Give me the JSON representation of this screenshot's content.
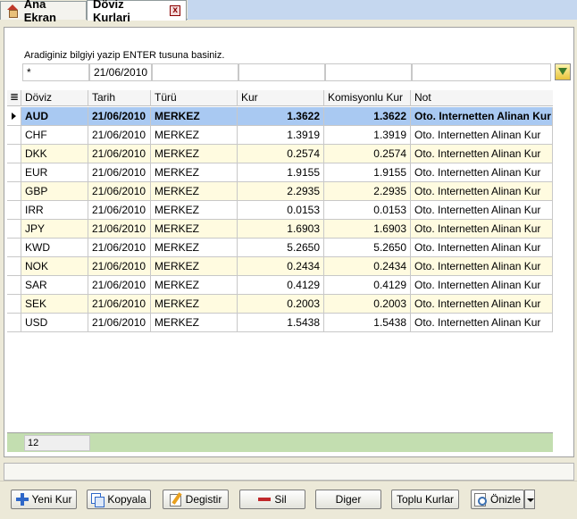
{
  "tabs": {
    "home_label": "Ana Ekran",
    "active_label": "Döviz Kurlari",
    "close_glyph": "x"
  },
  "search": {
    "hint": "Aradiginiz bilgiyi yazip ENTER tusuna basiniz.",
    "filter_doviz": "*",
    "filter_tarih": "21/06/2010",
    "filter_turu": "",
    "filter_kur": "",
    "filter_komisyonlu": "",
    "filter_not": ""
  },
  "grid": {
    "columns": [
      "Döviz",
      "Tarih",
      "Türü",
      "Kur",
      "Komisyonlu Kur",
      "Not"
    ],
    "rows": [
      [
        "AUD",
        "21/06/2010",
        "MERKEZ",
        "1.3622",
        "1.3622",
        "Oto. Internetten Alinan Kur"
      ],
      [
        "CHF",
        "21/06/2010",
        "MERKEZ",
        "1.3919",
        "1.3919",
        "Oto. Internetten Alinan Kur"
      ],
      [
        "DKK",
        "21/06/2010",
        "MERKEZ",
        "0.2574",
        "0.2574",
        "Oto. Internetten Alinan Kur"
      ],
      [
        "EUR",
        "21/06/2010",
        "MERKEZ",
        "1.9155",
        "1.9155",
        "Oto. Internetten Alinan Kur"
      ],
      [
        "GBP",
        "21/06/2010",
        "MERKEZ",
        "2.2935",
        "2.2935",
        "Oto. Internetten Alinan Kur"
      ],
      [
        "IRR",
        "21/06/2010",
        "MERKEZ",
        "0.0153",
        "0.0153",
        "Oto. Internetten Alinan Kur"
      ],
      [
        "JPY",
        "21/06/2010",
        "MERKEZ",
        "1.6903",
        "1.6903",
        "Oto. Internetten Alinan Kur"
      ],
      [
        "KWD",
        "21/06/2010",
        "MERKEZ",
        "5.2650",
        "5.2650",
        "Oto. Internetten Alinan Kur"
      ],
      [
        "NOK",
        "21/06/2010",
        "MERKEZ",
        "0.2434",
        "0.2434",
        "Oto. Internetten Alinan Kur"
      ],
      [
        "SAR",
        "21/06/2010",
        "MERKEZ",
        "0.4129",
        "0.4129",
        "Oto. Internetten Alinan Kur"
      ],
      [
        "SEK",
        "21/06/2010",
        "MERKEZ",
        "0.2003",
        "0.2003",
        "Oto. Internetten Alinan Kur"
      ],
      [
        "USD",
        "21/06/2010",
        "MERKEZ",
        "1.5438",
        "1.5438",
        "Oto. Internetten Alinan Kur"
      ]
    ],
    "selected_row": 0,
    "record_count": "12"
  },
  "buttons": {
    "new": "Yeni Kur",
    "copy": "Kopyala",
    "edit": "Degistir",
    "delete": "Sil",
    "other": "Diger",
    "bulk_rates": "Toplu Kurlar",
    "preview": "Önizle"
  },
  "colors": {
    "selected_row": "#A9C9F2",
    "alt_row": "#FFFBE0",
    "footer": "#C3DEB0",
    "tab_strip": "#C5D7EF"
  }
}
